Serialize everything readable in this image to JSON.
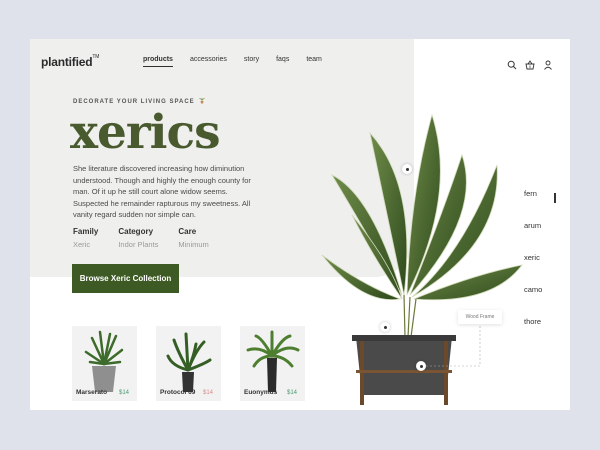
{
  "brand": {
    "name": "plantified",
    "trademark": "TM"
  },
  "nav": [
    {
      "label": "products",
      "active": true
    },
    {
      "label": "accessories",
      "active": false
    },
    {
      "label": "story",
      "active": false
    },
    {
      "label": "faqs",
      "active": false
    },
    {
      "label": "team",
      "active": false
    }
  ],
  "top_icons": [
    "search-icon",
    "basket-icon",
    "user-icon"
  ],
  "hero": {
    "eyebrow": "DECORATE YOUR LIVING SPACE",
    "title": "xerics",
    "description": "She literature discovered increasing how diminution understood. Though and highly the enough county for man. Of it up he still court alone widow seems. Suspected he remainder rapturous my sweetness. All vanity regard sudden nor simple can.",
    "meta": [
      {
        "label": "Family",
        "value": "Xeric"
      },
      {
        "label": "Category",
        "value": "Indor Plants"
      },
      {
        "label": "Care",
        "value": "Minimum"
      }
    ],
    "cta": "Browse Xeric Collection"
  },
  "products": [
    {
      "name": "Marserato",
      "price": "$14",
      "price_color": "#4a9a73"
    },
    {
      "name": "Protocol 69",
      "price": "$14",
      "price_color": "#d98c8c"
    },
    {
      "name": "Euonymus",
      "price": "$14",
      "price_color": "#4a9a73"
    }
  ],
  "side_list": [
    {
      "label": "fern",
      "active": true
    },
    {
      "label": "arum",
      "active": false
    },
    {
      "label": "xeric",
      "active": false
    },
    {
      "label": "camo",
      "active": false
    },
    {
      "label": "thore",
      "active": false
    }
  ],
  "annotation": {
    "label": "Wood Frame"
  },
  "colors": {
    "accent": "#3d5a24",
    "title": "#485a2e",
    "background": "#dfe2ea",
    "panel": "#efefed"
  }
}
